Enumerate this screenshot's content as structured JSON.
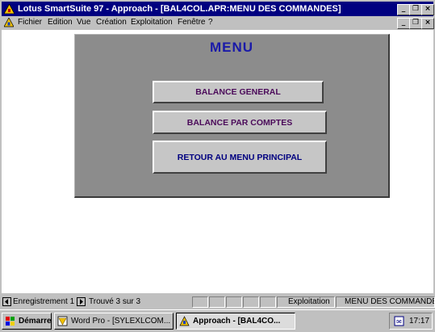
{
  "window": {
    "title": "Lotus SmartSuite 97   - Approach - [BAL4COL.APR:MENU DES COMMANDES]",
    "caption_buttons": {
      "minimize": "_",
      "restore": "❐",
      "close": "×"
    }
  },
  "menubar": {
    "items": [
      "Fichier",
      "Edition",
      "Vue",
      "Création",
      "Exploitation",
      "Fenêtre",
      "?"
    ],
    "doc_buttons": {
      "minimize": "_",
      "restore": "❐",
      "close": "×"
    }
  },
  "form": {
    "title": "MENU",
    "buttons": [
      "BALANCE GENERAL",
      "BALANCE PAR  COMPTES",
      "RETOUR AU MENU PRINCIPAL"
    ]
  },
  "statusbar": {
    "record": "Enregistrement 1",
    "found": "Trouvé 3 sur 3",
    "mode": "Exploitation",
    "view": "MENU DES COMMANDE"
  },
  "taskbar": {
    "start": "Démarrer",
    "tasks": [
      {
        "label": "Word Pro - [SYLEXLCOM...",
        "active": false,
        "icon": "word-pro-icon"
      },
      {
        "label": "Approach - [BAL4CO...",
        "active": true,
        "icon": "approach-icon"
      }
    ],
    "clock": "17:17"
  },
  "colors": {
    "titlebar": "#000080",
    "panel": "#8c8c8c",
    "menu_title": "#1a1aa8",
    "button_text": "#4b0a5a"
  }
}
